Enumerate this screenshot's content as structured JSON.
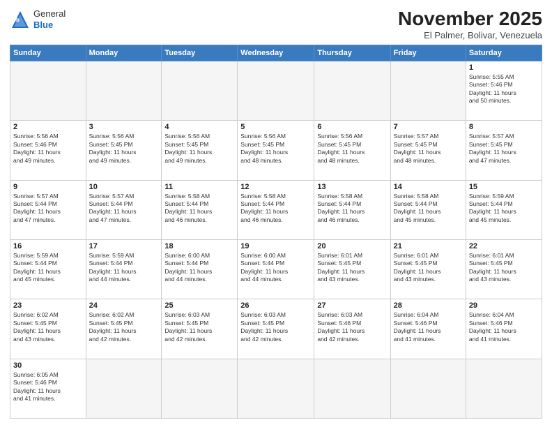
{
  "header": {
    "logo_general": "General",
    "logo_blue": "Blue",
    "month_title": "November 2025",
    "location": "El Palmer, Bolivar, Venezuela"
  },
  "weekdays": [
    "Sunday",
    "Monday",
    "Tuesday",
    "Wednesday",
    "Thursday",
    "Friday",
    "Saturday"
  ],
  "weeks": [
    [
      {
        "day": "",
        "info": ""
      },
      {
        "day": "",
        "info": ""
      },
      {
        "day": "",
        "info": ""
      },
      {
        "day": "",
        "info": ""
      },
      {
        "day": "",
        "info": ""
      },
      {
        "day": "",
        "info": ""
      },
      {
        "day": "1",
        "info": "Sunrise: 5:55 AM\nSunset: 5:46 PM\nDaylight: 11 hours\nand 50 minutes."
      }
    ],
    [
      {
        "day": "2",
        "info": "Sunrise: 5:56 AM\nSunset: 5:46 PM\nDaylight: 11 hours\nand 49 minutes."
      },
      {
        "day": "3",
        "info": "Sunrise: 5:56 AM\nSunset: 5:45 PM\nDaylight: 11 hours\nand 49 minutes."
      },
      {
        "day": "4",
        "info": "Sunrise: 5:56 AM\nSunset: 5:45 PM\nDaylight: 11 hours\nand 49 minutes."
      },
      {
        "day": "5",
        "info": "Sunrise: 5:56 AM\nSunset: 5:45 PM\nDaylight: 11 hours\nand 48 minutes."
      },
      {
        "day": "6",
        "info": "Sunrise: 5:56 AM\nSunset: 5:45 PM\nDaylight: 11 hours\nand 48 minutes."
      },
      {
        "day": "7",
        "info": "Sunrise: 5:57 AM\nSunset: 5:45 PM\nDaylight: 11 hours\nand 48 minutes."
      },
      {
        "day": "8",
        "info": "Sunrise: 5:57 AM\nSunset: 5:45 PM\nDaylight: 11 hours\nand 47 minutes."
      }
    ],
    [
      {
        "day": "9",
        "info": "Sunrise: 5:57 AM\nSunset: 5:44 PM\nDaylight: 11 hours\nand 47 minutes."
      },
      {
        "day": "10",
        "info": "Sunrise: 5:57 AM\nSunset: 5:44 PM\nDaylight: 11 hours\nand 47 minutes."
      },
      {
        "day": "11",
        "info": "Sunrise: 5:58 AM\nSunset: 5:44 PM\nDaylight: 11 hours\nand 46 minutes."
      },
      {
        "day": "12",
        "info": "Sunrise: 5:58 AM\nSunset: 5:44 PM\nDaylight: 11 hours\nand 46 minutes."
      },
      {
        "day": "13",
        "info": "Sunrise: 5:58 AM\nSunset: 5:44 PM\nDaylight: 11 hours\nand 46 minutes."
      },
      {
        "day": "14",
        "info": "Sunrise: 5:58 AM\nSunset: 5:44 PM\nDaylight: 11 hours\nand 45 minutes."
      },
      {
        "day": "15",
        "info": "Sunrise: 5:59 AM\nSunset: 5:44 PM\nDaylight: 11 hours\nand 45 minutes."
      }
    ],
    [
      {
        "day": "16",
        "info": "Sunrise: 5:59 AM\nSunset: 5:44 PM\nDaylight: 11 hours\nand 45 minutes."
      },
      {
        "day": "17",
        "info": "Sunrise: 5:59 AM\nSunset: 5:44 PM\nDaylight: 11 hours\nand 44 minutes."
      },
      {
        "day": "18",
        "info": "Sunrise: 6:00 AM\nSunset: 5:44 PM\nDaylight: 11 hours\nand 44 minutes."
      },
      {
        "day": "19",
        "info": "Sunrise: 6:00 AM\nSunset: 5:44 PM\nDaylight: 11 hours\nand 44 minutes."
      },
      {
        "day": "20",
        "info": "Sunrise: 6:01 AM\nSunset: 5:45 PM\nDaylight: 11 hours\nand 43 minutes."
      },
      {
        "day": "21",
        "info": "Sunrise: 6:01 AM\nSunset: 5:45 PM\nDaylight: 11 hours\nand 43 minutes."
      },
      {
        "day": "22",
        "info": "Sunrise: 6:01 AM\nSunset: 5:45 PM\nDaylight: 11 hours\nand 43 minutes."
      }
    ],
    [
      {
        "day": "23",
        "info": "Sunrise: 6:02 AM\nSunset: 5:45 PM\nDaylight: 11 hours\nand 43 minutes."
      },
      {
        "day": "24",
        "info": "Sunrise: 6:02 AM\nSunset: 5:45 PM\nDaylight: 11 hours\nand 42 minutes."
      },
      {
        "day": "25",
        "info": "Sunrise: 6:03 AM\nSunset: 5:45 PM\nDaylight: 11 hours\nand 42 minutes."
      },
      {
        "day": "26",
        "info": "Sunrise: 6:03 AM\nSunset: 5:45 PM\nDaylight: 11 hours\nand 42 minutes."
      },
      {
        "day": "27",
        "info": "Sunrise: 6:03 AM\nSunset: 5:46 PM\nDaylight: 11 hours\nand 42 minutes."
      },
      {
        "day": "28",
        "info": "Sunrise: 6:04 AM\nSunset: 5:46 PM\nDaylight: 11 hours\nand 41 minutes."
      },
      {
        "day": "29",
        "info": "Sunrise: 6:04 AM\nSunset: 5:46 PM\nDaylight: 11 hours\nand 41 minutes."
      }
    ],
    [
      {
        "day": "30",
        "info": "Sunrise: 6:05 AM\nSunset: 5:46 PM\nDaylight: 11 hours\nand 41 minutes."
      },
      {
        "day": "",
        "info": ""
      },
      {
        "day": "",
        "info": ""
      },
      {
        "day": "",
        "info": ""
      },
      {
        "day": "",
        "info": ""
      },
      {
        "day": "",
        "info": ""
      },
      {
        "day": "",
        "info": ""
      }
    ]
  ]
}
